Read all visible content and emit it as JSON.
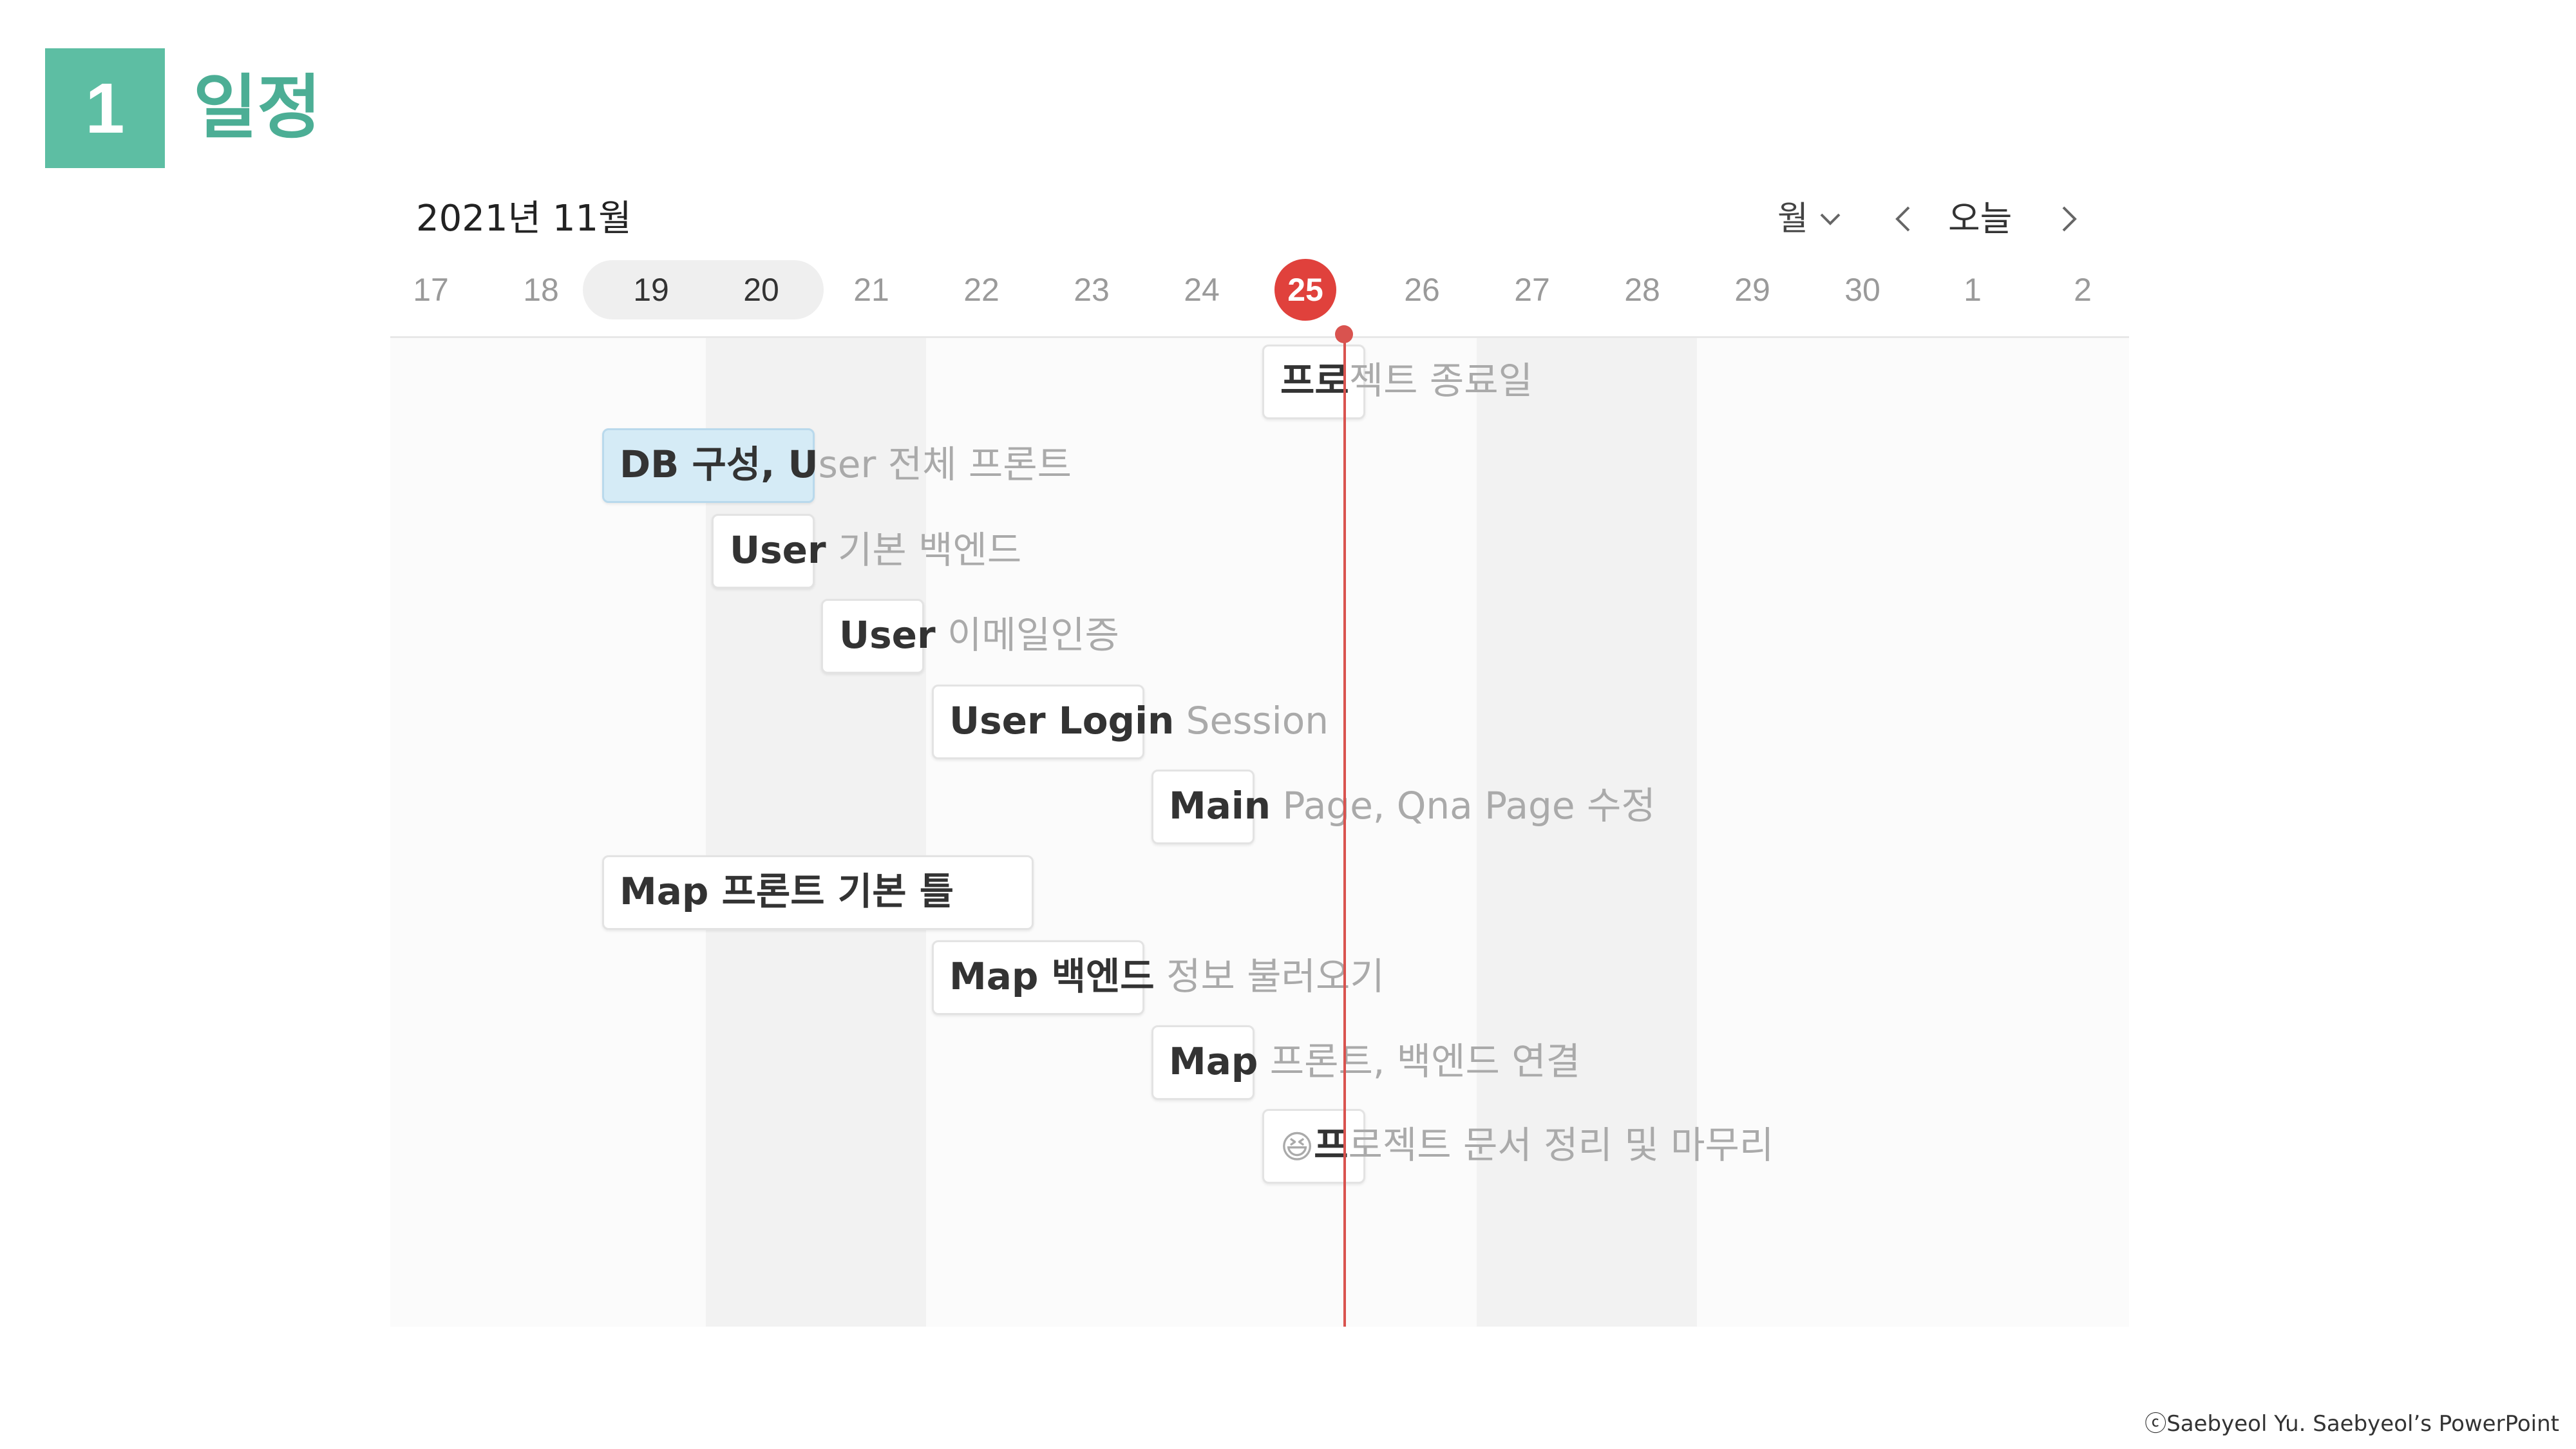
{
  "section": {
    "number": "1",
    "title": "일정"
  },
  "calendar": {
    "month_title": "2021년 11월",
    "view_label": "월",
    "today_label": "오늘",
    "days": [
      "17",
      "18",
      "19",
      "20",
      "21",
      "22",
      "23",
      "24",
      "25",
      "26",
      "27",
      "28",
      "29",
      "30",
      "1",
      "2"
    ],
    "selected_days": [
      "19",
      "20"
    ],
    "today": "25"
  },
  "events": [
    {
      "strong": "프로",
      "rest": "젝트 종료일"
    },
    {
      "strong": "DB 구성, U",
      "rest": "ser 전체 프론트"
    },
    {
      "strong": "User",
      "rest": " 기본 백엔드"
    },
    {
      "strong": "User",
      "rest": " 이메일인증"
    },
    {
      "strong": "User Login",
      "rest": " Session"
    },
    {
      "strong": "Main",
      "rest": " Page, Qna Page 수정"
    },
    {
      "strong": "Map 프론트 기본 틀",
      "rest": ""
    },
    {
      "strong": "Map 백엔드",
      "rest": " 정보 불러오기"
    },
    {
      "strong": "Map",
      "rest": " 프론트, 백엔드 연결"
    },
    {
      "emoji": "😆",
      "strong": "프",
      "rest": "로젝트 문서 정리 및 마무리"
    }
  ],
  "colors": {
    "accent": "#5dbea3",
    "today": "#d9534f",
    "event_blue": "#d5ebf6"
  },
  "footer": "ⓒSaebyeol Yu. Saebyeol’s PowerPoint"
}
